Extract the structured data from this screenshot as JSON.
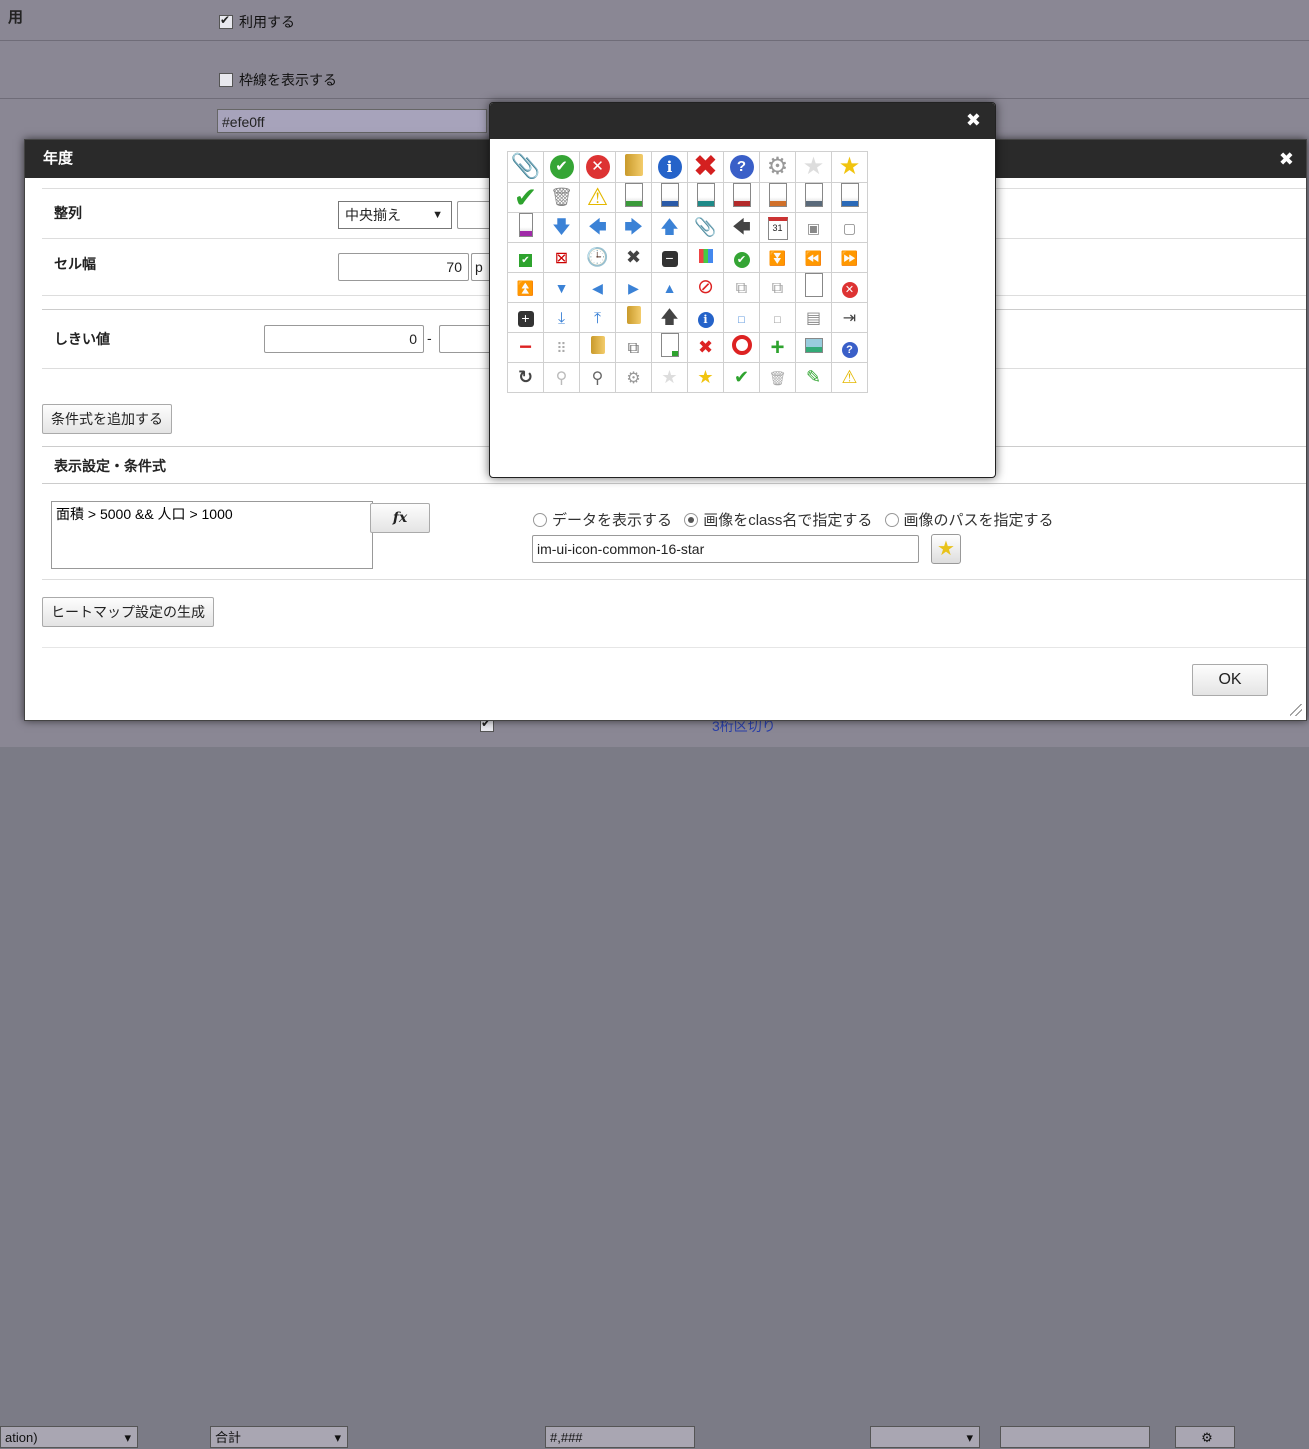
{
  "background": {
    "row_label": "用",
    "use_checkbox_label": "利用する",
    "border_checkbox_label": "枠線を表示する",
    "color_value": "#efe0ff",
    "bottom": {
      "col1": "ation)",
      "col2": "合計",
      "col3": "#,###",
      "col4": "3桁区切り"
    }
  },
  "dialog": {
    "title": "年度",
    "align_label": "整列",
    "align_value": "中央揃え",
    "cell_width_label": "セル幅",
    "cell_width_value": "70",
    "cell_width_unit": "p",
    "threshold_label": "しきい値",
    "threshold_from": "0",
    "threshold_sep": "-",
    "add_condition_button": "条件式を追加する",
    "display_section_title": "表示設定・条件式",
    "condition_text": "面積 > 5000 && 人口 > 1000",
    "fx_button": "fx",
    "radio_options": [
      "データを表示する",
      "画像をclass名で指定する",
      "画像のパスを指定する"
    ],
    "radio_selected": 1,
    "class_name_value": "im-ui-icon-common-16-star",
    "generate_button": "ヒートマップ設定の生成",
    "ok_button": "OK"
  },
  "palette": {
    "rows": [
      [
        "paperclip-icon",
        "check-circle-icon",
        "x-circle-icon",
        "folder-icon",
        "info-icon",
        "red-x-icon",
        "question-icon",
        "gear-icon",
        "star-empty-icon",
        "star-icon"
      ],
      [
        "checkmark-icon",
        "trash-icon",
        "warning-icon",
        "image-doc-icon",
        "doc-blue-icon",
        "doc-teal-icon",
        "doc-red-icon",
        "chart-doc-icon",
        "text-doc-icon",
        "doc-list-icon"
      ],
      [
        "tube-icon",
        "arrow-down-icon",
        "arrow-left-icon",
        "arrow-right-icon",
        "arrow-up-icon",
        "paperclip-icon",
        "back-arrow-icon",
        "calendar-icon",
        "square-dot-icon",
        "square-icon"
      ],
      [
        "green-check-box-icon",
        "window-x-icon",
        "clock-icon",
        "x-small-icon",
        "minus-box-icon",
        "color-grid-icon",
        "check-circle-icon",
        "double-down-icon",
        "rewind-icon",
        "fast-forward-icon"
      ],
      [
        "double-up-icon",
        "triangle-down-icon",
        "triangle-left-icon",
        "triangle-right-icon",
        "triangle-up-icon",
        "no-entry-icon",
        "copy-icon",
        "copy-icon",
        "page-icon",
        "x-circle-icon"
      ],
      [
        "plus-box-icon",
        "download-icon",
        "upload-icon",
        "folder-icon",
        "home-up-icon",
        "info-icon",
        "small-square-blue-icon",
        "small-square-icon",
        "list-icon",
        "logout-icon"
      ],
      [
        "minus-red-icon",
        "dots-icon",
        "folder-add-icon",
        "popout-icon",
        "doc-add-icon",
        "red-x-icon",
        "red-ring-icon",
        "plus-green-icon",
        "picture-icon",
        "question-icon"
      ],
      [
        "refresh-icon",
        "search-icon",
        "search-icon",
        "gear-icon",
        "star-empty-icon",
        "star-icon",
        "checkmark-icon",
        "trash-icon",
        "pencil-icon",
        "warning-icon"
      ]
    ]
  }
}
